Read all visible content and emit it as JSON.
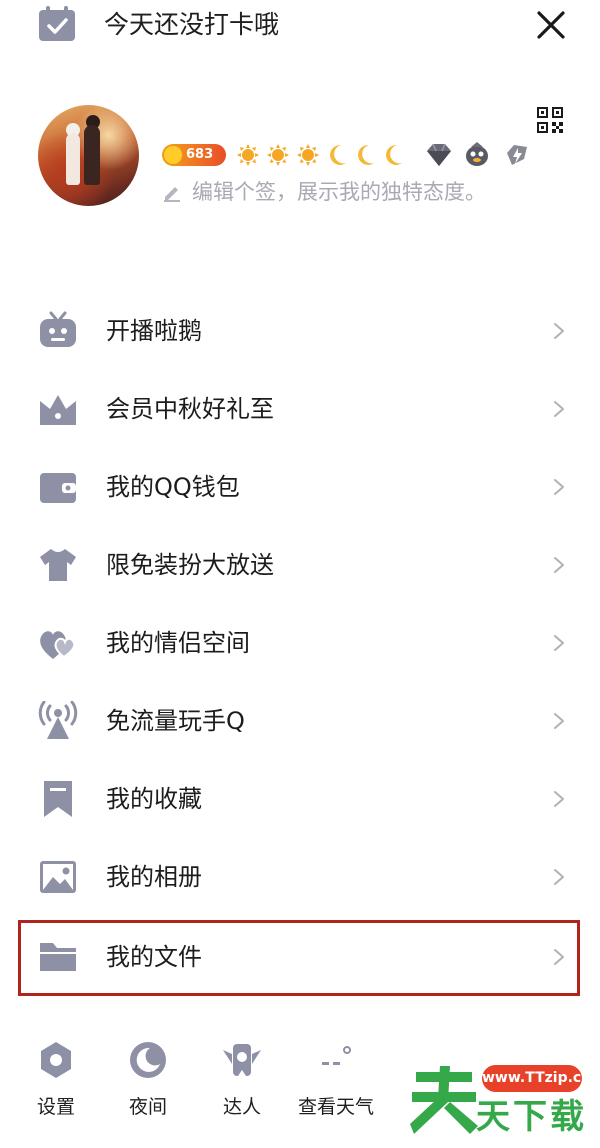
{
  "top_bar": {
    "checkin_text": "今天还没打卡哦",
    "close_icon": "close-icon",
    "checkin_icon": "calendar-check-icon"
  },
  "profile": {
    "level": "683",
    "signature_placeholder": "编辑个签，展示我的独特态度。",
    "qr_icon": "qr-code-icon"
  },
  "menu": {
    "items": [
      {
        "label": "开播啦鹅",
        "icon": "tv-robot-icon"
      },
      {
        "label": "会员中秋好礼至",
        "icon": "crown-icon"
      },
      {
        "label": "我的QQ钱包",
        "icon": "wallet-icon"
      },
      {
        "label": "限免装扮大放送",
        "icon": "tshirt-icon"
      },
      {
        "label": "我的情侣空间",
        "icon": "hearts-icon"
      },
      {
        "label": "免流量玩手Q",
        "icon": "signal-tower-icon"
      },
      {
        "label": "我的收藏",
        "icon": "bookmark-icon"
      },
      {
        "label": "我的相册",
        "icon": "image-icon"
      },
      {
        "label": "我的文件",
        "icon": "folder-icon"
      }
    ]
  },
  "bottom": {
    "items": [
      {
        "label": "设置",
        "icon": "settings-icon"
      },
      {
        "label": "夜间",
        "icon": "moon-icon"
      },
      {
        "label": "达人",
        "icon": "badge-wings-icon"
      },
      {
        "label": "查看天气",
        "icon": "weather-icon"
      }
    ]
  },
  "watermark": {
    "url": "www.TTzip.com",
    "text": "天下载",
    "big_char": "天"
  },
  "colors": {
    "icon_gray": "#8e90a6",
    "highlight_red": "#b1241d",
    "watermark_green": "#35a84a"
  }
}
